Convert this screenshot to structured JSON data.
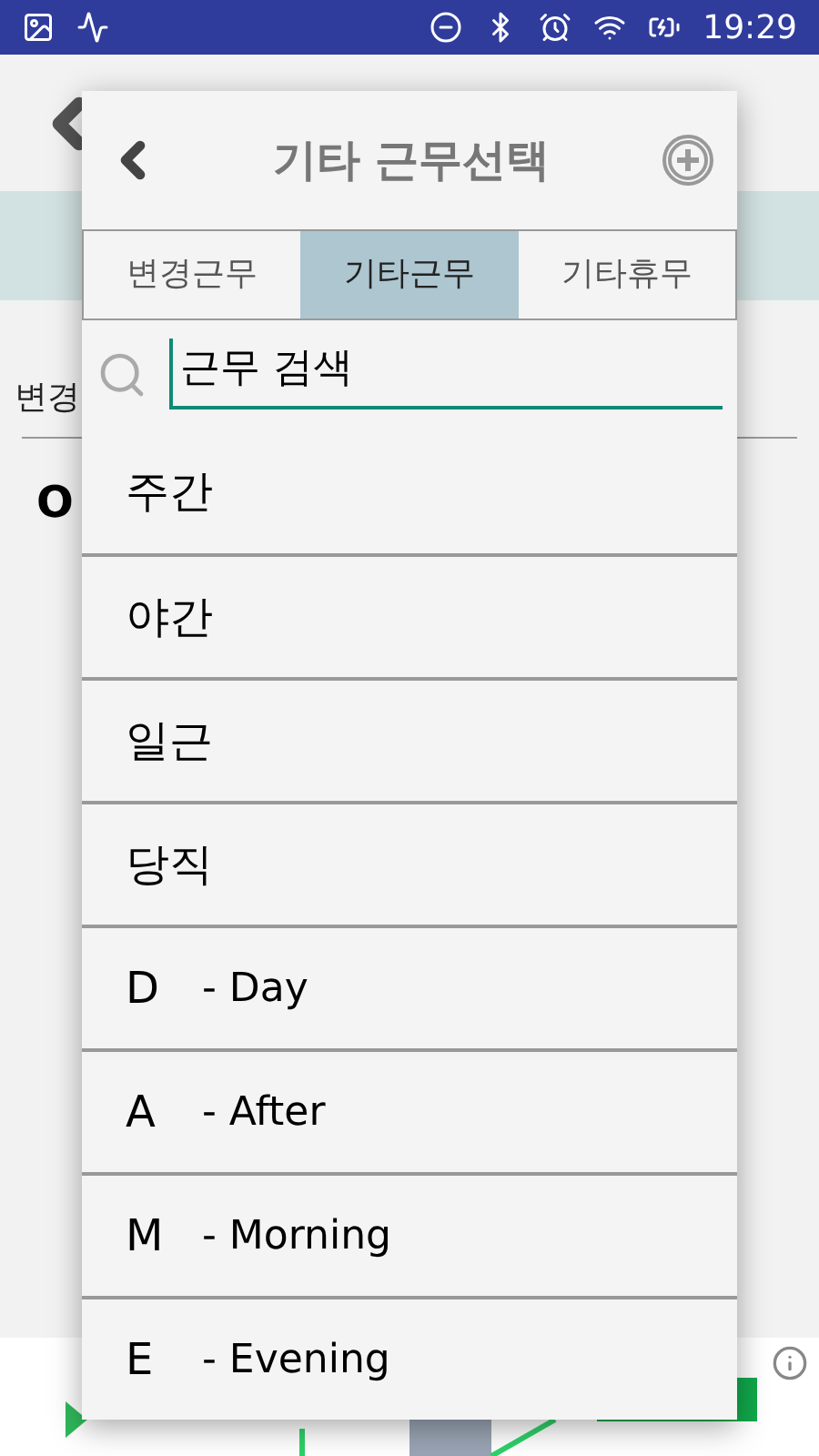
{
  "status_bar": {
    "time": "19:29"
  },
  "background": {
    "section_label": "변경",
    "row_text": "O"
  },
  "dialog": {
    "title": "기타 근무선택",
    "tabs": [
      {
        "label": "변경근무",
        "selected": false
      },
      {
        "label": "기타근무",
        "selected": true
      },
      {
        "label": "기타휴무",
        "selected": false
      }
    ],
    "search": {
      "value": "근무 검색"
    },
    "items": [
      {
        "kind": "plain",
        "label": "주간"
      },
      {
        "kind": "plain",
        "label": "야간"
      },
      {
        "kind": "plain",
        "label": "일근"
      },
      {
        "kind": "plain",
        "label": "당직"
      },
      {
        "kind": "code",
        "code": "D",
        "label": "- Day"
      },
      {
        "kind": "code",
        "code": "A",
        "label": "- After"
      },
      {
        "kind": "code",
        "code": "M",
        "label": "- Morning"
      },
      {
        "kind": "code",
        "code": "E",
        "label": "- Evening"
      }
    ]
  }
}
